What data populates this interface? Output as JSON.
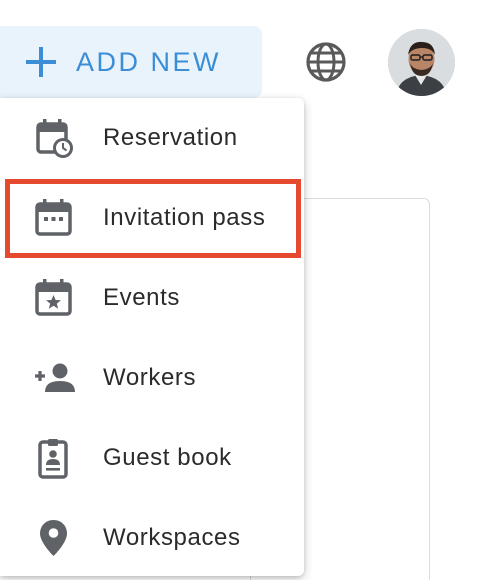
{
  "header": {
    "add_new_label": "ADD NEW",
    "plus_icon": "plus-icon",
    "globe_icon": "globe-icon",
    "avatar": "user-avatar",
    "accent_color": "#3b8ed6",
    "button_bg": "#e9f3fb"
  },
  "menu": {
    "items": [
      {
        "label": "Reservation",
        "icon": "calendar-clock-icon"
      },
      {
        "label": "Invitation pass",
        "icon": "calendar-dots-icon"
      },
      {
        "label": "Events",
        "icon": "calendar-star-icon"
      },
      {
        "label": "Workers",
        "icon": "add-person-icon"
      },
      {
        "label": "Guest book",
        "icon": "badge-id-icon"
      },
      {
        "label": "Workspaces",
        "icon": "location-pin-icon"
      }
    ],
    "highlighted_item": "Invitation pass",
    "highlight_color": "#e64a2e",
    "icon_color": "#5f6368"
  }
}
